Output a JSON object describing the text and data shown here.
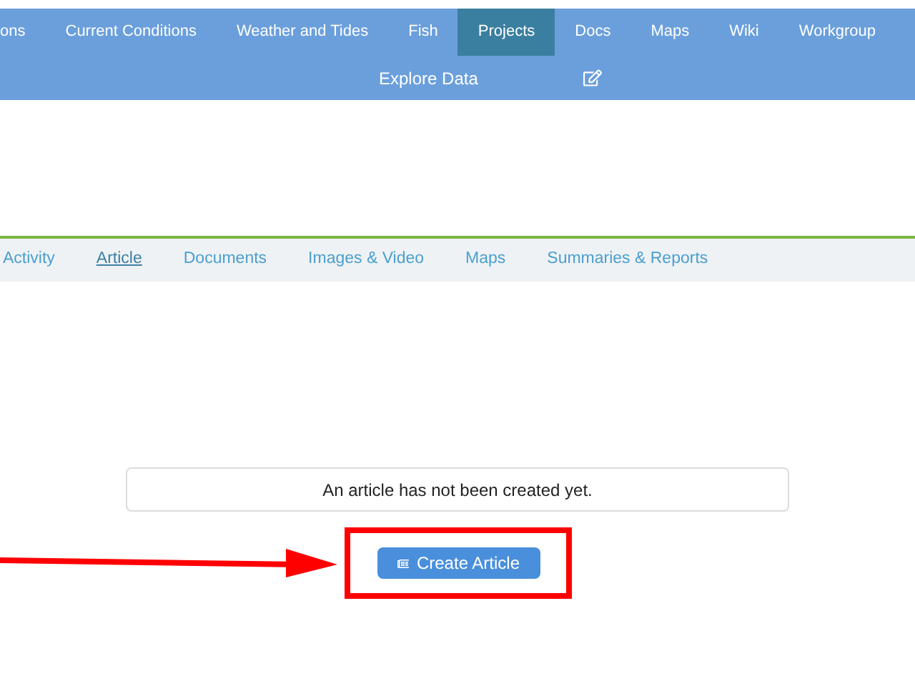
{
  "nav": {
    "items": [
      {
        "label": "ons",
        "selected": false
      },
      {
        "label": "Current Conditions",
        "selected": false
      },
      {
        "label": "Weather and Tides",
        "selected": false
      },
      {
        "label": "Fish",
        "selected": false
      },
      {
        "label": "Projects",
        "selected": true
      },
      {
        "label": "Docs",
        "selected": false
      },
      {
        "label": "Maps",
        "selected": false
      },
      {
        "label": "Wiki",
        "selected": false
      },
      {
        "label": "Workgroup",
        "selected": false
      }
    ],
    "second_row": {
      "label": "Explore Data"
    }
  },
  "subnav": {
    "tabs": [
      {
        "label": "Activity",
        "selected": false
      },
      {
        "label": "Article",
        "selected": true
      },
      {
        "label": "Documents",
        "selected": false
      },
      {
        "label": "Images & Video",
        "selected": false
      },
      {
        "label": "Maps",
        "selected": false
      },
      {
        "label": "Summaries & Reports",
        "selected": false
      }
    ]
  },
  "message": "An article has not been created yet.",
  "button": {
    "label": "Create Article"
  }
}
